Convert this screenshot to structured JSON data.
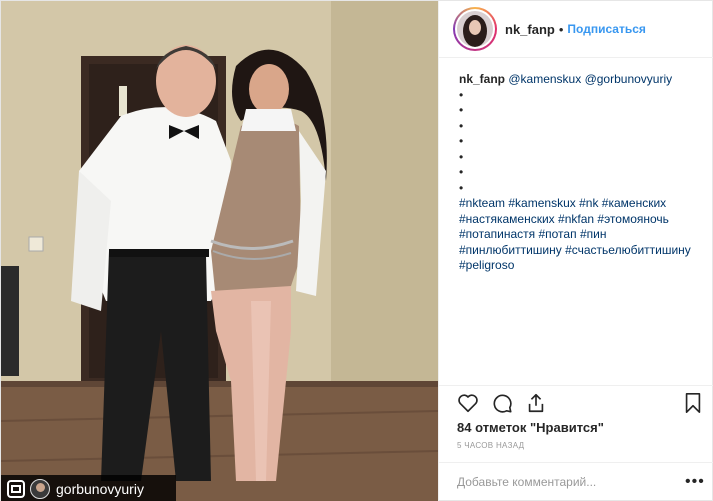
{
  "post": {
    "username": "nk_fanp",
    "separator": "•",
    "follow_label": "Подписаться",
    "photo": {
      "repost_user": "gorbunovyuriy"
    },
    "caption": {
      "user": "nk_fanp",
      "mentions": [
        "@kamenskux",
        "@gorbunovyuriy"
      ],
      "bullets": [
        "•",
        "•",
        "•",
        "•",
        "•",
        "•",
        "•"
      ],
      "hashtags": [
        "#nkteam",
        "#kamenskux",
        "#nk",
        "#каменских",
        "#настякаменских",
        "#nkfan",
        "#этомояночь",
        "#потапинастя",
        "#потап",
        "#пин",
        "#пинлюбиттишину",
        "#счастьелюбиттишину",
        "#peligroso"
      ]
    },
    "likes_text": "84 отметок \"Нравится\"",
    "time_text": "5 ЧАСОВ НАЗАД",
    "comment_placeholder": "Добавьте комментарий...",
    "more_label": "•••",
    "icons": [
      "heart-icon",
      "comment-icon",
      "share-icon",
      "bookmark-icon",
      "repost-icon",
      "more-options-icon"
    ],
    "colors": {
      "follow": "#3897f0",
      "hashtag": "#003569",
      "text": "#262626",
      "muted": "#999999"
    }
  }
}
